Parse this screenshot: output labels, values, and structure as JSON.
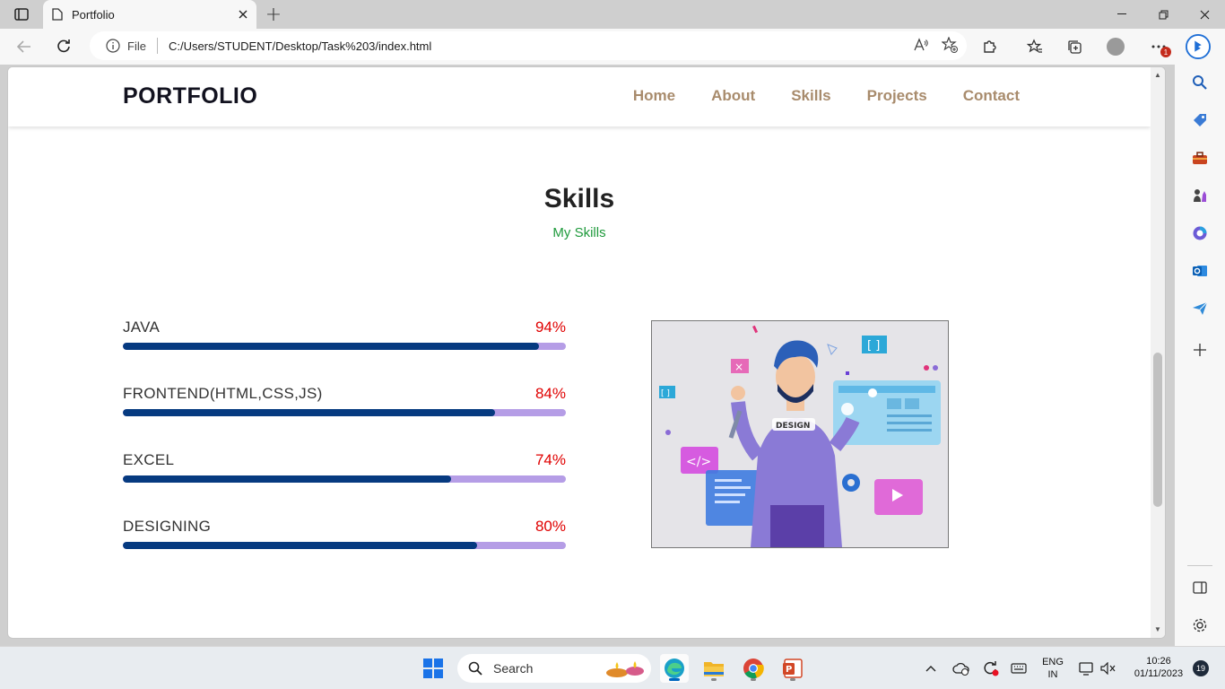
{
  "browser": {
    "tab_title": "Portfolio",
    "file_label": "File",
    "url": "C:/Users/STUDENT/Desktop/Task%203/index.html",
    "notification_count": "1"
  },
  "site": {
    "logo": "PORTFOLIO",
    "menu": [
      "Home",
      "About",
      "Skills",
      "Projects",
      "Contact"
    ],
    "section_title": "Skills",
    "section_subtitle": "My Skills",
    "skills": [
      {
        "name": "JAVA",
        "percent_label": "94%",
        "level": 94
      },
      {
        "name": "FRONTEND(HTML,CSS,JS)",
        "percent_label": "84%",
        "level": 84
      },
      {
        "name": "EXCEL",
        "percent_label": "74%",
        "level": 74
      },
      {
        "name": "DESIGNING",
        "percent_label": "80%",
        "level": 80
      }
    ],
    "illustration_text": "DESIGN"
  },
  "colors": {
    "bar_fill": "#063a80",
    "bar_track": "#b59de6",
    "percent": "#e00000",
    "menu": "#a88b6c",
    "subtitle": "#1f9a3c"
  },
  "taskbar": {
    "search_label": "Search",
    "lang_line1": "ENG",
    "lang_line2": "IN",
    "time": "10:26",
    "date": "01/11/2023",
    "notif_count": "19"
  }
}
